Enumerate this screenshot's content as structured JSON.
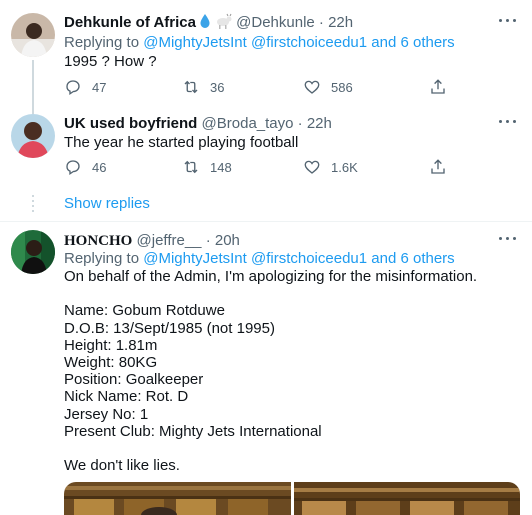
{
  "tweets": [
    {
      "name": "Dehkunle of Africa",
      "handle": "@Dehkunle",
      "sep": "·",
      "time": "22h",
      "replying_prefix": "Replying to",
      "replying_to": [
        "@MightyJetsInt",
        "@firstchoiceedu1"
      ],
      "replying_and": "and 6 others",
      "text": "1995 ? How ?",
      "replies": "47",
      "retweets": "36",
      "likes": "586"
    },
    {
      "name": "UK used boyfriend",
      "handle": "@Broda_tayo",
      "sep": "·",
      "time": "22h",
      "text": "The year he started playing football",
      "replies": "46",
      "retweets": "148",
      "likes": "1.6K"
    },
    {
      "name": "HONCHO",
      "handle": "@jeffre__",
      "sep": "·",
      "time": "20h",
      "replying_prefix": "Replying to",
      "replying_to": [
        "@MightyJetsInt",
        "@firstchoiceedu1"
      ],
      "replying_and": "and 6 others",
      "text_lines": [
        "On behalf of the Admin, I'm apologizing for the misinformation.",
        "",
        "Name: Gobum Rotduwe",
        "D.O.B: 13/Sept/1985 (not 1995)",
        "Height: 1.81m",
        "Weight: 80KG",
        "Position: Goalkeeper",
        "Nick Name: Rot. D",
        "Jersey No: 1",
        "Present Club: Mighty Jets International",
        "",
        "We don't like lies."
      ]
    }
  ],
  "show_replies": "Show replies",
  "colors": {
    "accent": "#1d9bf0",
    "secondary_text": "#536471",
    "primary_text": "#0f1419",
    "thread_line": "#cfd9de"
  },
  "icons": [
    "reply-icon",
    "retweet-icon",
    "like-icon",
    "share-icon",
    "more-icon",
    "water-drop-emoji",
    "goat-emoji"
  ]
}
